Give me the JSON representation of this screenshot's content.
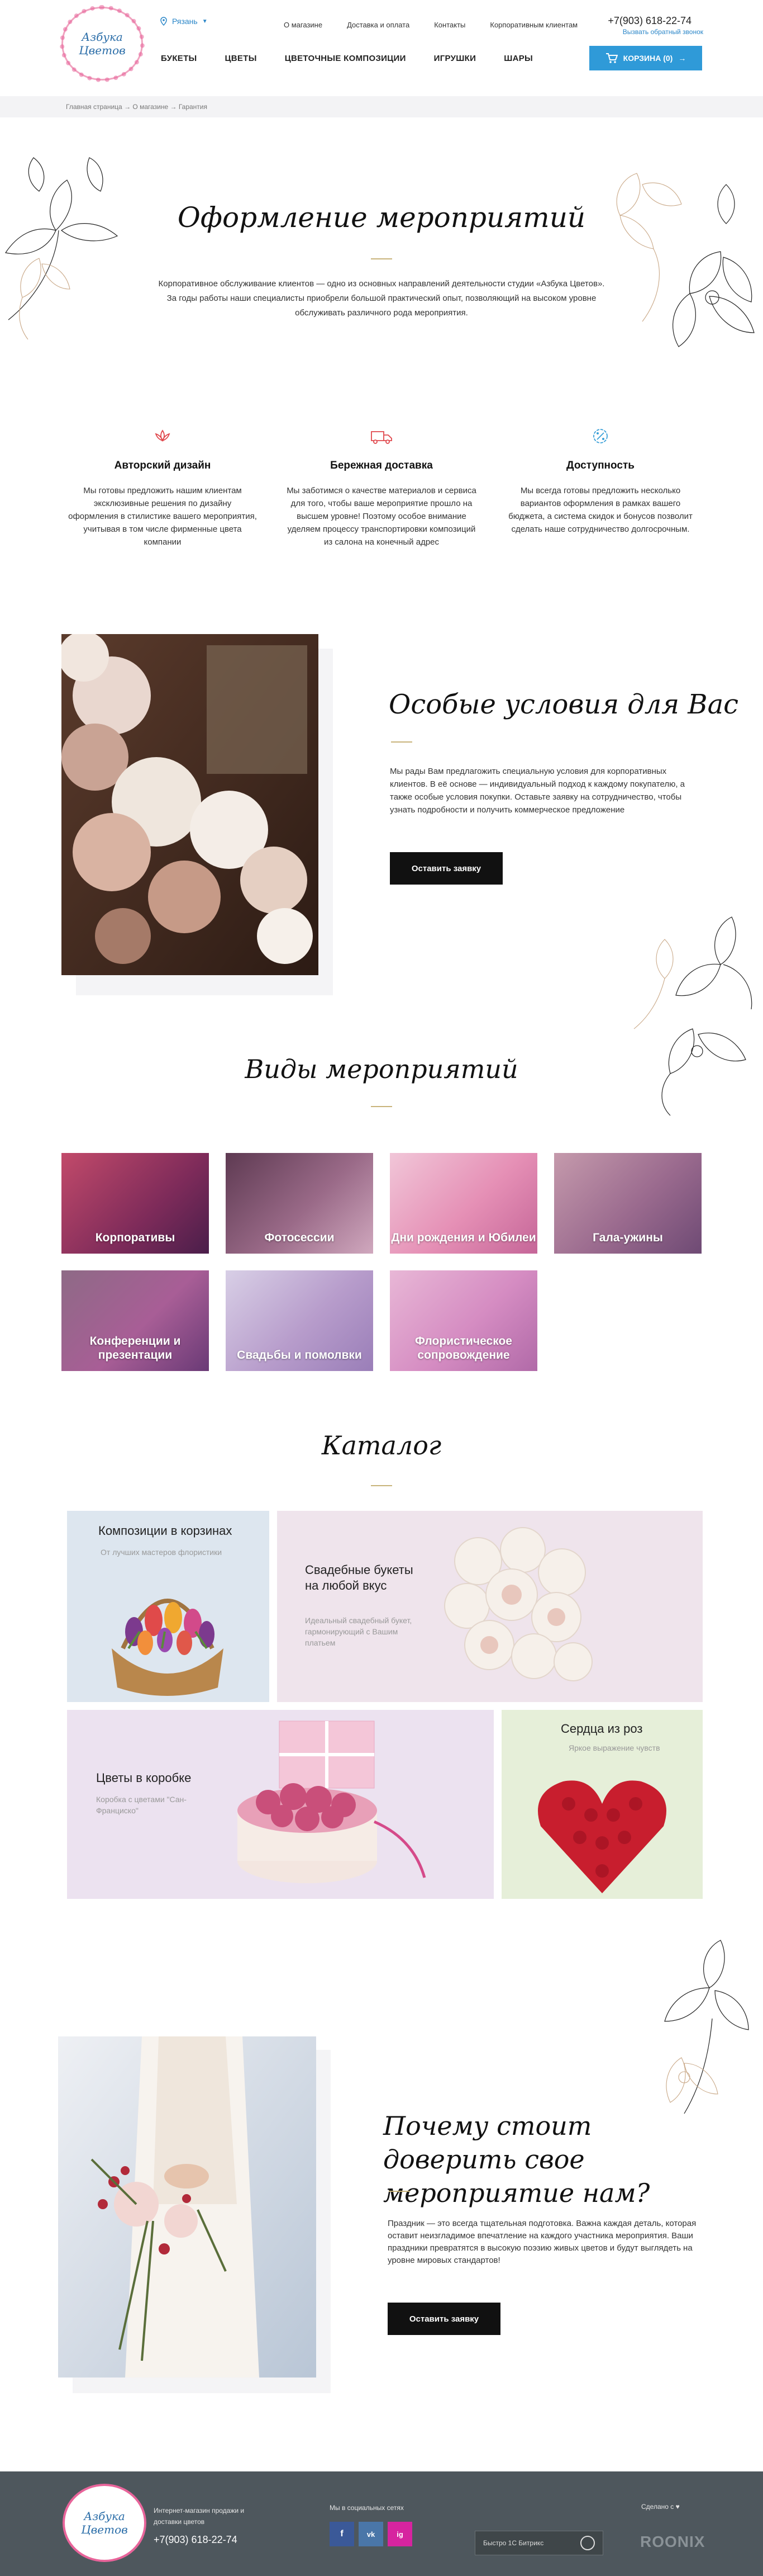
{
  "header": {
    "logo_line1": "Азбука",
    "logo_line2": "Цветов",
    "city": "Рязань",
    "top_nav": [
      "О магазине",
      "Доставка и оплата",
      "Контакты",
      "Корпоративным клиентам"
    ],
    "phone": "+7(903) 618-22-74",
    "callback": "Вызвать обратный звонок",
    "main_nav": [
      "БУКЕТЫ",
      "ЦВЕТЫ",
      "ЦВЕТОЧНЫЕ КОМПОЗИЦИИ",
      "ИГРУШКИ",
      "ШАРЫ"
    ],
    "cart_label": "КОРЗИНА (0)",
    "cart_arrow": "→"
  },
  "breadcrumbs": "Главная страница → О магазине → Гарантия",
  "intro": {
    "title": "Оформление мероприятий",
    "text": "Корпоративное обслуживание клиентов — одно из основных направлений деятельности студии «Азбука Цветов». За годы работы наши специалисты приобрели большой практический опыт, позволяющий на высоком уровне обслуживать различного рода мероприятия."
  },
  "features": [
    {
      "icon": "design-icon",
      "title": "Авторский дизайн",
      "text": "Мы готовы предложить нашим клиентам эксклюзивные решения по дизайну оформления в стилистике вашего мероприятия, учитывая в том числе фирменные цвета компании"
    },
    {
      "icon": "truck-icon",
      "title": "Бережная доставка",
      "text": "Мы заботимся о качестве материалов и сервиса для того, чтобы ваше мероприятие прошло на высшем уровне! Поэтому особое внимание уделяем процессу транспортировки композиций из салона на конечный адрес"
    },
    {
      "icon": "discount-icon",
      "title": "Доступность",
      "text": "Мы всегда готовы предложить несколько вариантов оформления в рамках вашего бюджета, а система скидок и бонусов позволит сделать наше сотрудничество долгосрочным."
    }
  ],
  "special": {
    "title": "Особые условия для Вас",
    "text": "Мы рады Вам предлагожить специальную условия для корпоративных клиентов. В её основе — индивидуальный подход к каждому покупателю, а также особые условия покупки. Оставьте заявку на сотрудничество, чтобы узнать подробности и получить коммерческое предложение",
    "button": "Оставить заявку"
  },
  "kinds": {
    "title": "Виды мероприятий",
    "items": [
      "Корпоративы",
      "Фотосессии",
      "Дни рождения и Юбилеи",
      "Гала-ужины",
      "Конференции и презентации",
      "Свадьбы и помолвки",
      "Флористическое сопровождение"
    ]
  },
  "catalog": {
    "title": "Каталог",
    "cards": [
      {
        "title": "Композиции в корзинах",
        "sub": "От лучших мастеров флористики"
      },
      {
        "title": "Свадебные букеты на любой вкус",
        "sub": "Идеальный свадебный букет, гармонирующий с Вашим платьем"
      },
      {
        "title": "Цветы в коробке",
        "sub": "Коробка с цветами \"Сан-Франциско\""
      },
      {
        "title": "Сердца из роз",
        "sub": "Яркое выражение чувств"
      }
    ]
  },
  "why": {
    "title": "Почему стоит доверить свое мероприятие нам?",
    "text": "Праздник — это всегда тщательная подготовка. Важна каждая деталь, которая оставит неизгладимое впечатление на каждого участника мероприятия. Ваши праздники превратятся в высокую поэзию живых цветов и будут выглядеть на уровне мировых стандартов!",
    "button": "Оставить заявку"
  },
  "footer": {
    "desc": "Интернет-магазин продажи и доставки цветов",
    "phone": "+7(903) 618-22-74",
    "social_label": "Мы в социальных сетях",
    "social": [
      "f",
      "vk",
      "ig"
    ],
    "badge": "Быстро 1С Битрикс",
    "made": "Сделано с",
    "studio": "ROONIX"
  },
  "colors": {
    "accent": "#2f9ad8",
    "gold": "#c8b37a",
    "dark": "#111111",
    "footer": "#4e575d"
  }
}
